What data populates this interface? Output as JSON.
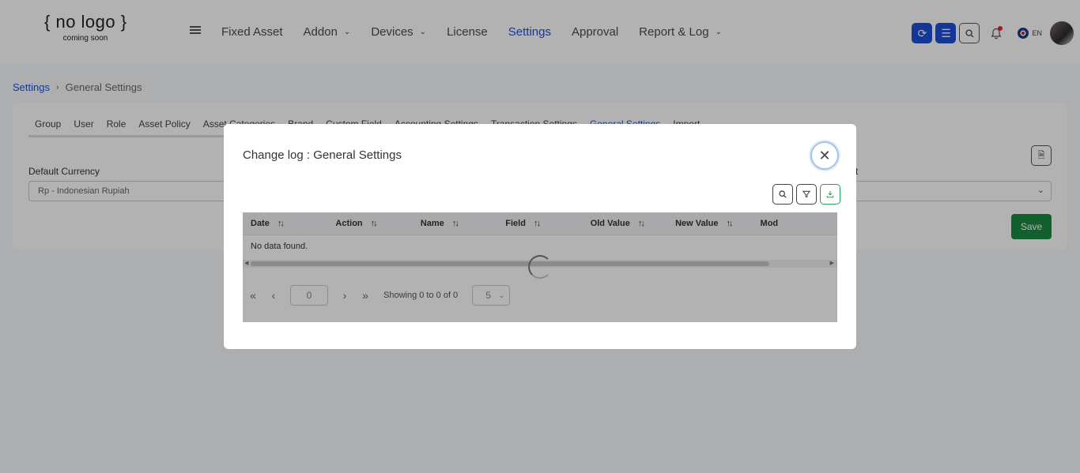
{
  "logo": {
    "main": "{ no logo }",
    "sub": "coming soon"
  },
  "nav": [
    {
      "label": "Fixed Asset",
      "dropdown": false
    },
    {
      "label": "Addon",
      "dropdown": true
    },
    {
      "label": "Devices",
      "dropdown": true
    },
    {
      "label": "License",
      "dropdown": false
    },
    {
      "label": "Settings",
      "dropdown": false,
      "active": true
    },
    {
      "label": "Approval",
      "dropdown": false
    },
    {
      "label": "Report & Log",
      "dropdown": true
    }
  ],
  "header_right": {
    "language": "EN"
  },
  "breadcrumb": {
    "root": "Settings",
    "current": "General Settings"
  },
  "tabs": [
    "Group",
    "User",
    "Role",
    "Asset Policy",
    "Asset Categories",
    "Brand",
    "Custom Field",
    "Accounting Settings",
    "Transaction Settings",
    "General Settings",
    "Import"
  ],
  "active_tab": "General Settings",
  "form": {
    "default_currency_label": "Default Currency",
    "default_currency_value": "Rp - Indonesian Rupiah",
    "second_label_fragment": "t",
    "save_label": "Save"
  },
  "modal": {
    "title": "Change log : General Settings",
    "columns": [
      "Date",
      "Action",
      "Name",
      "Field",
      "Old Value",
      "New Value",
      "Mod"
    ],
    "empty_text": "No data found.",
    "page_input": "0",
    "showing_text": "Showing 0 to 0 of 0",
    "page_size": "5"
  },
  "colors": {
    "primary": "#1d4fd6",
    "save_green": "#1a8a42",
    "export_green": "#2a9c52"
  }
}
